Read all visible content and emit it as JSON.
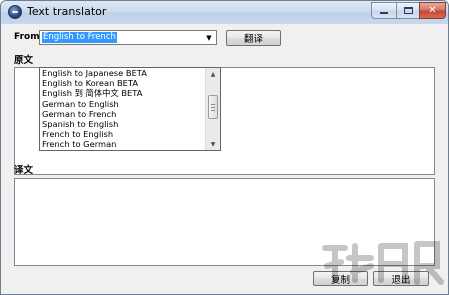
{
  "window": {
    "title": "Text translator",
    "controls": {
      "minimize": "",
      "maximize": "",
      "close": "✕"
    }
  },
  "toolbar": {
    "from_label": "From",
    "direction_selected": "English to French",
    "translate_button": "翻译"
  },
  "dropdown": {
    "items": [
      "English to Japanese BETA",
      "English to Korean BETA",
      "English 到 简体中文 BETA",
      "German to English",
      "German to French",
      "Spanish to English",
      "French to English",
      "French to German"
    ],
    "scroll_up_glyph": "▲",
    "scroll_down_glyph": "▼"
  },
  "source": {
    "label": "原文",
    "text": ""
  },
  "result": {
    "label": "译文",
    "text": ""
  },
  "footer": {
    "copy_button": "复制",
    "exit_button": "退出"
  },
  "colors": {
    "selection": "#3399ff",
    "window_bg": "#f0f0f0",
    "close_button": "#c4432f"
  },
  "icons": {
    "app": "globe-icon",
    "combo_arrow": "chevron-down-icon"
  }
}
